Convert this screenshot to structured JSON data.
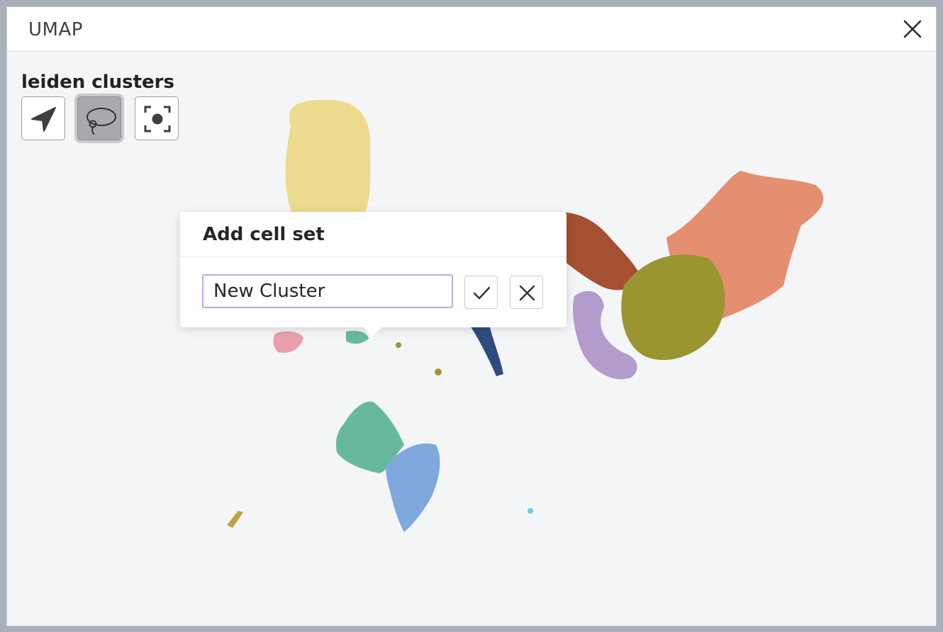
{
  "window": {
    "title": "UMAP"
  },
  "view": {
    "label": "leiden clusters",
    "tools": [
      {
        "name": "pointer",
        "icon": "navigation-arrow-icon",
        "active": false
      },
      {
        "name": "lasso",
        "icon": "lasso-icon",
        "active": true
      },
      {
        "name": "recenter",
        "icon": "recenter-icon",
        "active": false
      }
    ]
  },
  "popover": {
    "title": "Add cell set",
    "input_value": "New Cluster",
    "confirm_icon": "check-icon",
    "cancel_icon": "close-icon"
  },
  "colors": {
    "yellow": "#ecdb8e",
    "salmon": "#e58e70",
    "olive": "#9a9530",
    "brown": "#a54f33",
    "lavender": "#b39ccc",
    "green": "#66ba9b",
    "blue": "#7ea8de",
    "navy": "#2e4c7e",
    "pink": "#e8a1ab",
    "gold": "#c0a040",
    "cyan": "#6fc7e3"
  }
}
